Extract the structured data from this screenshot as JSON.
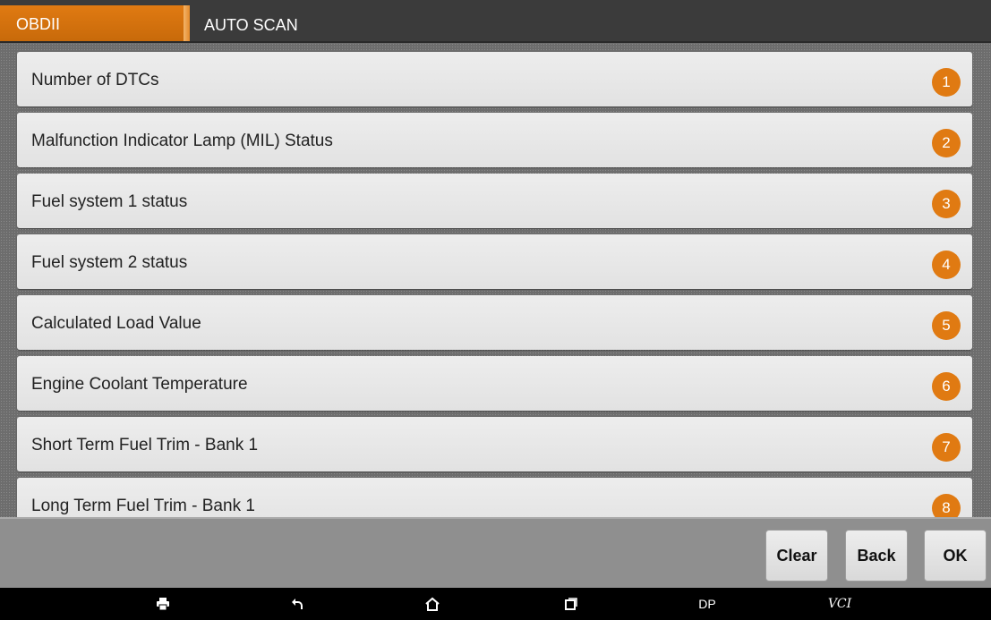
{
  "header": {
    "tab_label": "OBDII",
    "title": "AUTO SCAN"
  },
  "items": [
    {
      "label": "Number of DTCs",
      "number": "1"
    },
    {
      "label": "Malfunction Indicator Lamp (MIL) Status",
      "number": "2"
    },
    {
      "label": "Fuel system 1 status",
      "number": "3"
    },
    {
      "label": "Fuel system 2 status",
      "number": "4"
    },
    {
      "label": "Calculated Load Value",
      "number": "5"
    },
    {
      "label": "Engine Coolant Temperature",
      "number": "6"
    },
    {
      "label": "Short Term Fuel Trim - Bank 1",
      "number": "7"
    },
    {
      "label": "Long Term Fuel Trim - Bank 1",
      "number": "8"
    }
  ],
  "toolbar": {
    "clear_label": "Clear",
    "back_label": "Back",
    "ok_label": "OK"
  },
  "navbar": {
    "icons": [
      "print-icon",
      "back-arrow-icon",
      "home-icon",
      "recent-apps-icon"
    ],
    "dp_label": "DP",
    "vci_label": "VCI"
  },
  "colors": {
    "accent": "#e07a12",
    "header_bg": "#3b3b3b",
    "row_bg": "#e8e8e8",
    "toolbar_bg": "#8f8f8f"
  }
}
